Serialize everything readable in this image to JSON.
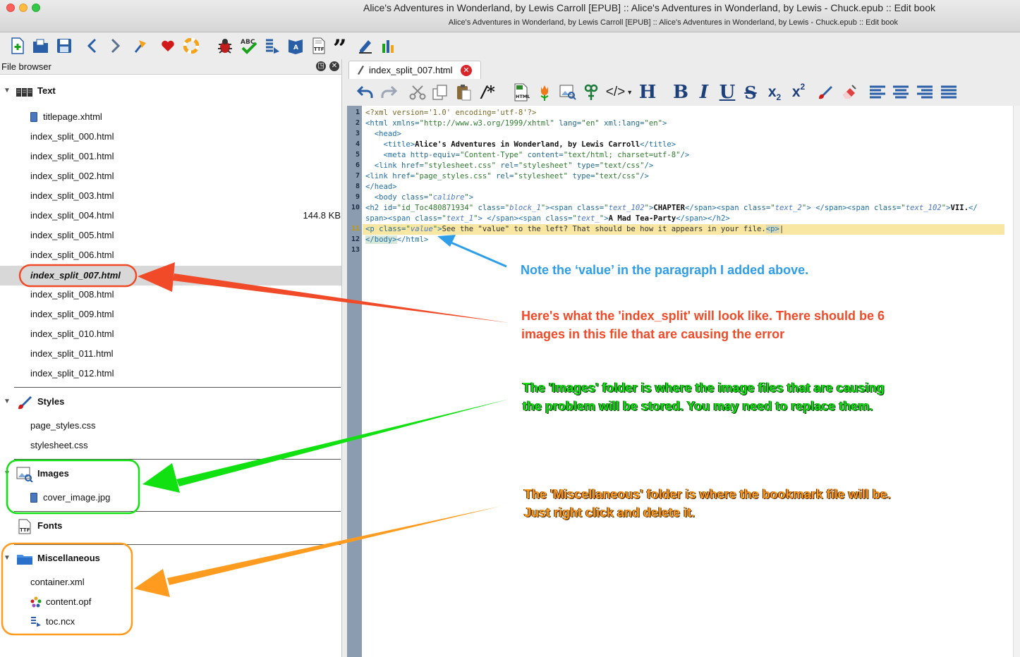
{
  "window": {
    "title": "Alice's Adventures in Wonderland, by Lewis Carroll [EPUB] :: Alice's Adventures in Wonderland, by Lewis - Chuck.epub :: Edit book",
    "subtitle": "Alice's Adventures in Wonderland, by Lewis Carroll [EPUB] :: Alice's Adventures in Wonderland, by Lewis - Chuck.epub :: Edit book"
  },
  "toolbar": {
    "buttons": [
      "new-file",
      "open-book",
      "save",
      "back",
      "forward",
      "checkpoint",
      "donate",
      "help",
      "check-book",
      "spell-check",
      "reports",
      "toc",
      "metadata",
      "fonts",
      "quotes",
      "insert-tag",
      "stats"
    ]
  },
  "file_browser": {
    "title": "File browser",
    "text_folder": {
      "label": "Text",
      "items": [
        {
          "name": "titlepage.xhtml",
          "size": ""
        },
        {
          "name": "index_split_000.html",
          "size": ""
        },
        {
          "name": "index_split_001.html",
          "size": ""
        },
        {
          "name": "index_split_002.html",
          "size": ""
        },
        {
          "name": "index_split_003.html",
          "size": ""
        },
        {
          "name": "index_split_004.html",
          "size": "144.8 KB"
        },
        {
          "name": "index_split_005.html",
          "size": ""
        },
        {
          "name": "index_split_006.html",
          "size": ""
        },
        {
          "name": "index_split_007.html",
          "size": ""
        },
        {
          "name": "index_split_008.html",
          "size": ""
        },
        {
          "name": "index_split_009.html",
          "size": ""
        },
        {
          "name": "index_split_010.html",
          "size": ""
        },
        {
          "name": "index_split_011.html",
          "size": ""
        },
        {
          "name": "index_split_012.html",
          "size": ""
        }
      ]
    },
    "styles_folder": {
      "label": "Styles",
      "items": [
        "page_styles.css",
        "stylesheet.css"
      ]
    },
    "images_folder": {
      "label": "Images",
      "items": [
        "cover_image.jpg"
      ]
    },
    "fonts_folder": {
      "label": "Fonts"
    },
    "misc_folder": {
      "label": "Miscellaneous",
      "items": [
        "container.xml",
        "content.opf",
        "toc.ncx"
      ]
    }
  },
  "editor": {
    "tab_label": "index_split_007.html",
    "current_line": 11,
    "line_numbers": [
      "1",
      "2",
      "3",
      "4",
      "5",
      "6",
      "7",
      "8",
      "9",
      "10",
      "",
      "11",
      "12",
      "13"
    ]
  },
  "annotations": {
    "blue": "Note the ‘value’ in the paragraph I added above.",
    "red_1": "Here's what the 'index_split' will look like. There should be 6",
    "red_2": "images in this file that are causing the error",
    "green_1": "The 'Images' folder is where the image files that are causing",
    "green_2": "the problem  will be stored. You may need to replace them.",
    "orange_1": "The 'Miscellaneous' folder is where the bookmark file will be.",
    "orange_2": "Just right click and delete it."
  },
  "colors": {
    "red": "#f04a28",
    "blue": "#2e9ee8",
    "green": "#11e011",
    "orange": "#ff9b1e",
    "line_highlight": "#f7e7a3",
    "gutter": "#8c9cb0"
  }
}
